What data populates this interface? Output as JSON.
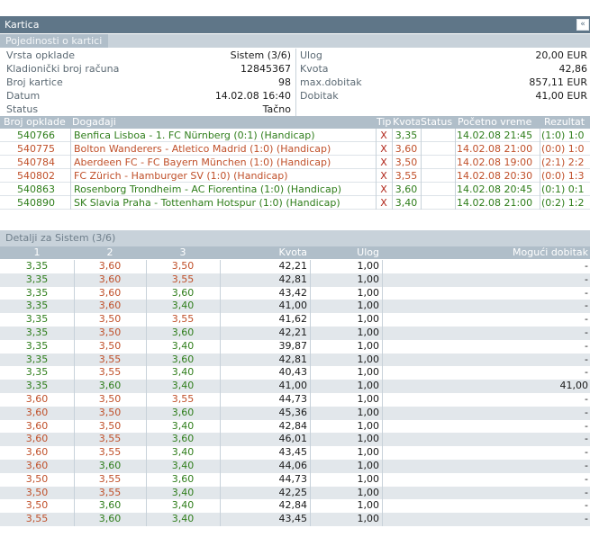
{
  "panel": {
    "title": "Kartica",
    "collapse_icon": "double-chevron-icon"
  },
  "details": {
    "subtitle": "Pojedinosti o kartici",
    "left": [
      {
        "label": "Vrsta opklade",
        "value": "Sistem (3/6)"
      },
      {
        "label": "Kladionički broj računa",
        "value": "12845367"
      },
      {
        "label": "Broj kartice",
        "value": "98"
      },
      {
        "label": "Datum",
        "value": "14.02.08 16:40"
      },
      {
        "label": "Status",
        "value": "Tačno"
      }
    ],
    "right": [
      {
        "label": "Ulog",
        "value": "20,00 EUR"
      },
      {
        "label": "Kvota",
        "value": "42,86"
      },
      {
        "label": "max.dobitak",
        "value": "857,11 EUR"
      },
      {
        "label": "Dobitak",
        "value": "41,00 EUR"
      }
    ]
  },
  "bets": {
    "headers": {
      "id": "Broj opklade",
      "event": "Događaji",
      "tip": "Tip",
      "kvota": "Kvota",
      "status": "Status",
      "start": "Početno vreme",
      "result": "Rezultat"
    },
    "rows": [
      {
        "id": "540766",
        "event": "Benfica Lisboa - 1. FC Nürnberg (0:1) (Handicap)",
        "tip": "X",
        "kvota": "3,35",
        "status": "won",
        "start": "14.02.08 21:45",
        "result": "(1:0) 1:0",
        "color": "green"
      },
      {
        "id": "540775",
        "event": "Bolton Wanderers - Atletico Madrid (1:0) (Handicap)",
        "tip": "X",
        "kvota": "3,60",
        "status": "lost",
        "start": "14.02.08 21:00",
        "result": "(0:0) 1:0",
        "color": "orange"
      },
      {
        "id": "540784",
        "event": "Aberdeen FC - FC Bayern München (1:0) (Handicap)",
        "tip": "X",
        "kvota": "3,50",
        "status": "lost",
        "start": "14.02.08 19:00",
        "result": "(2:1) 2:2",
        "color": "orange"
      },
      {
        "id": "540802",
        "event": "FC Zürich - Hamburger SV (1:0) (Handicap)",
        "tip": "X",
        "kvota": "3,55",
        "status": "lost",
        "start": "14.02.08 20:30",
        "result": "(0:0) 1:3",
        "color": "orange"
      },
      {
        "id": "540863",
        "event": "Rosenborg Trondheim - AC Fiorentina (1:0) (Handicap)",
        "tip": "X",
        "kvota": "3,60",
        "status": "won",
        "start": "14.02.08 20:45",
        "result": "(0:1) 0:1",
        "color": "green"
      },
      {
        "id": "540890",
        "event": "SK Slavia Praha - Tottenham Hotspur (1:0) (Handicap)",
        "tip": "X",
        "kvota": "3,40",
        "status": "won",
        "start": "14.02.08 21:00",
        "result": "(0:2) 1:2",
        "color": "green"
      }
    ]
  },
  "system": {
    "title": "Detalji za Sistem (3/6)",
    "headers": {
      "c1": "1",
      "c2": "2",
      "c3": "3",
      "kvota": "Kvota",
      "ulog": "Ulog",
      "dobitak": "Mogući dobitak"
    },
    "rows": [
      {
        "a": "3,35",
        "ac": "green",
        "b": "3,60",
        "bc": "orange",
        "c": "3,50",
        "cc": "orange",
        "kvota": "42,21",
        "ulog": "1,00",
        "dobitak": "-"
      },
      {
        "a": "3,35",
        "ac": "green",
        "b": "3,60",
        "bc": "orange",
        "c": "3,55",
        "cc": "orange",
        "kvota": "42,81",
        "ulog": "1,00",
        "dobitak": "-"
      },
      {
        "a": "3,35",
        "ac": "green",
        "b": "3,60",
        "bc": "orange",
        "c": "3,60",
        "cc": "green",
        "kvota": "43,42",
        "ulog": "1,00",
        "dobitak": "-"
      },
      {
        "a": "3,35",
        "ac": "green",
        "b": "3,60",
        "bc": "orange",
        "c": "3,40",
        "cc": "green",
        "kvota": "41,00",
        "ulog": "1,00",
        "dobitak": "-"
      },
      {
        "a": "3,35",
        "ac": "green",
        "b": "3,50",
        "bc": "orange",
        "c": "3,55",
        "cc": "orange",
        "kvota": "41,62",
        "ulog": "1,00",
        "dobitak": "-"
      },
      {
        "a": "3,35",
        "ac": "green",
        "b": "3,50",
        "bc": "orange",
        "c": "3,60",
        "cc": "green",
        "kvota": "42,21",
        "ulog": "1,00",
        "dobitak": "-"
      },
      {
        "a": "3,35",
        "ac": "green",
        "b": "3,50",
        "bc": "orange",
        "c": "3,40",
        "cc": "green",
        "kvota": "39,87",
        "ulog": "1,00",
        "dobitak": "-"
      },
      {
        "a": "3,35",
        "ac": "green",
        "b": "3,55",
        "bc": "orange",
        "c": "3,60",
        "cc": "green",
        "kvota": "42,81",
        "ulog": "1,00",
        "dobitak": "-"
      },
      {
        "a": "3,35",
        "ac": "green",
        "b": "3,55",
        "bc": "orange",
        "c": "3,40",
        "cc": "green",
        "kvota": "40,43",
        "ulog": "1,00",
        "dobitak": "-"
      },
      {
        "a": "3,35",
        "ac": "green",
        "b": "3,60",
        "bc": "green",
        "c": "3,40",
        "cc": "green",
        "kvota": "41,00",
        "ulog": "1,00",
        "dobitak": "41,00"
      },
      {
        "a": "3,60",
        "ac": "orange",
        "b": "3,50",
        "bc": "orange",
        "c": "3,55",
        "cc": "orange",
        "kvota": "44,73",
        "ulog": "1,00",
        "dobitak": "-"
      },
      {
        "a": "3,60",
        "ac": "orange",
        "b": "3,50",
        "bc": "orange",
        "c": "3,60",
        "cc": "green",
        "kvota": "45,36",
        "ulog": "1,00",
        "dobitak": "-"
      },
      {
        "a": "3,60",
        "ac": "orange",
        "b": "3,50",
        "bc": "orange",
        "c": "3,40",
        "cc": "green",
        "kvota": "42,84",
        "ulog": "1,00",
        "dobitak": "-"
      },
      {
        "a": "3,60",
        "ac": "orange",
        "b": "3,55",
        "bc": "orange",
        "c": "3,60",
        "cc": "green",
        "kvota": "46,01",
        "ulog": "1,00",
        "dobitak": "-"
      },
      {
        "a": "3,60",
        "ac": "orange",
        "b": "3,55",
        "bc": "orange",
        "c": "3,40",
        "cc": "green",
        "kvota": "43,45",
        "ulog": "1,00",
        "dobitak": "-"
      },
      {
        "a": "3,60",
        "ac": "orange",
        "b": "3,60",
        "bc": "green",
        "c": "3,40",
        "cc": "green",
        "kvota": "44,06",
        "ulog": "1,00",
        "dobitak": "-"
      },
      {
        "a": "3,50",
        "ac": "orange",
        "b": "3,55",
        "bc": "orange",
        "c": "3,60",
        "cc": "green",
        "kvota": "44,73",
        "ulog": "1,00",
        "dobitak": "-"
      },
      {
        "a": "3,50",
        "ac": "orange",
        "b": "3,55",
        "bc": "orange",
        "c": "3,40",
        "cc": "green",
        "kvota": "42,25",
        "ulog": "1,00",
        "dobitak": "-"
      },
      {
        "a": "3,50",
        "ac": "orange",
        "b": "3,60",
        "bc": "green",
        "c": "3,40",
        "cc": "green",
        "kvota": "42,84",
        "ulog": "1,00",
        "dobitak": "-"
      },
      {
        "a": "3,55",
        "ac": "orange",
        "b": "3,60",
        "bc": "green",
        "c": "3,40",
        "cc": "green",
        "kvota": "43,45",
        "ulog": "1,00",
        "dobitak": "-"
      }
    ]
  }
}
